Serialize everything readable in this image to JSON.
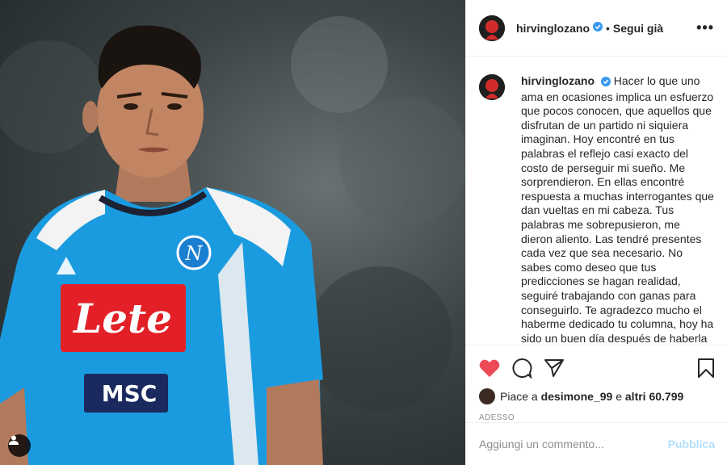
{
  "post": {
    "username": "hirvinglozano",
    "follow_state": "Segui già",
    "separator": "•",
    "more_label": "•••"
  },
  "caption": {
    "username": "hirvinglozano",
    "text": "Hacer lo que uno ama en ocasiones implica un esfuerzo que pocos conocen, que aquellos que disfrutan de un partido ni siquiera imaginan. Hoy encontré en tus palabras el reflejo casi exacto del costo de perseguir mi sueño. Me sorprendieron. En ellas encontré respuesta a muchas interrogantes que dan vueltas en mi cabeza. Tus palabras me sobrepusieron, me dieron aliento. Las tendré presentes cada vez que sea necesario. No sabes como deseo que tus predicciones se hagan realidad, seguiré trabajando con ganas para conseguirlo. Te agradezco mucho el haberme dedicado tu columna, hoy ha sido un buen día después de haberla leído. Un día más tranquilo y con la"
  },
  "likes": {
    "prefix": "Piace a",
    "user": "desimone_99",
    "middle": "e",
    "count": "altri 60.799"
  },
  "timestamp": "ADESSO",
  "comment": {
    "placeholder": "Aggiungi un commento...",
    "publish_label": "Pubblica"
  },
  "photo": {
    "sponsor": "Lete",
    "sponsor2": "MSC",
    "crest_letter": "N"
  },
  "colors": {
    "heart": "#ed4956",
    "verified": "#3897f0",
    "publish_disabled": "#b2dffc",
    "jersey": "#1a9be0"
  }
}
